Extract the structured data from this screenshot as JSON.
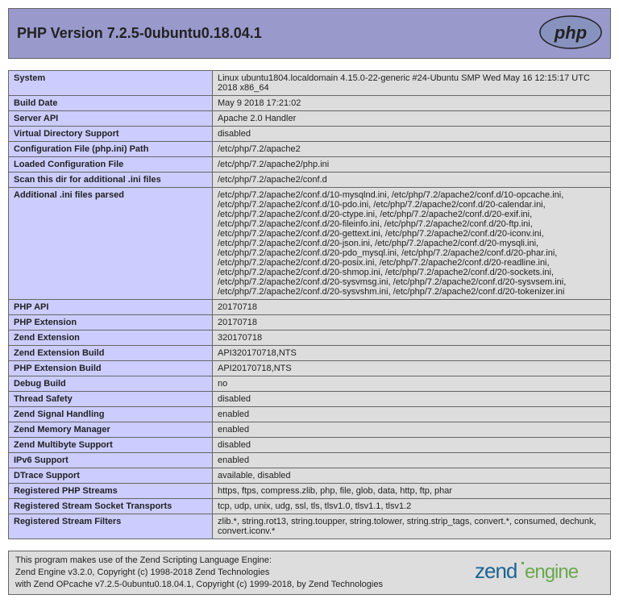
{
  "header": {
    "title": "PHP Version 7.2.5-0ubuntu0.18.04.1",
    "logo_text": "php"
  },
  "rows": [
    {
      "label": "System",
      "value": "Linux ubuntu1804.localdomain 4.15.0-22-generic #24-Ubuntu SMP Wed May 16 12:15:17 UTC 2018 x86_64"
    },
    {
      "label": "Build Date",
      "value": "May 9 2018 17:21:02"
    },
    {
      "label": "Server API",
      "value": "Apache 2.0 Handler"
    },
    {
      "label": "Virtual Directory Support",
      "value": "disabled"
    },
    {
      "label": "Configuration File (php.ini) Path",
      "value": "/etc/php/7.2/apache2"
    },
    {
      "label": "Loaded Configuration File",
      "value": "/etc/php/7.2/apache2/php.ini"
    },
    {
      "label": "Scan this dir for additional .ini files",
      "value": "/etc/php/7.2/apache2/conf.d"
    },
    {
      "label": "Additional .ini files parsed",
      "value": "/etc/php/7.2/apache2/conf.d/10-mysqlnd.ini, /etc/php/7.2/apache2/conf.d/10-opcache.ini, /etc/php/7.2/apache2/conf.d/10-pdo.ini, /etc/php/7.2/apache2/conf.d/20-calendar.ini, /etc/php/7.2/apache2/conf.d/20-ctype.ini, /etc/php/7.2/apache2/conf.d/20-exif.ini, /etc/php/7.2/apache2/conf.d/20-fileinfo.ini, /etc/php/7.2/apache2/conf.d/20-ftp.ini, /etc/php/7.2/apache2/conf.d/20-gettext.ini, /etc/php/7.2/apache2/conf.d/20-iconv.ini, /etc/php/7.2/apache2/conf.d/20-json.ini, /etc/php/7.2/apache2/conf.d/20-mysqli.ini, /etc/php/7.2/apache2/conf.d/20-pdo_mysql.ini, /etc/php/7.2/apache2/conf.d/20-phar.ini, /etc/php/7.2/apache2/conf.d/20-posix.ini, /etc/php/7.2/apache2/conf.d/20-readline.ini, /etc/php/7.2/apache2/conf.d/20-shmop.ini, /etc/php/7.2/apache2/conf.d/20-sockets.ini, /etc/php/7.2/apache2/conf.d/20-sysvmsg.ini, /etc/php/7.2/apache2/conf.d/20-sysvsem.ini, /etc/php/7.2/apache2/conf.d/20-sysvshm.ini, /etc/php/7.2/apache2/conf.d/20-tokenizer.ini"
    },
    {
      "label": "PHP API",
      "value": "20170718"
    },
    {
      "label": "PHP Extension",
      "value": "20170718"
    },
    {
      "label": "Zend Extension",
      "value": "320170718"
    },
    {
      "label": "Zend Extension Build",
      "value": "API320170718,NTS"
    },
    {
      "label": "PHP Extension Build",
      "value": "API20170718,NTS"
    },
    {
      "label": "Debug Build",
      "value": "no"
    },
    {
      "label": "Thread Safety",
      "value": "disabled"
    },
    {
      "label": "Zend Signal Handling",
      "value": "enabled"
    },
    {
      "label": "Zend Memory Manager",
      "value": "enabled"
    },
    {
      "label": "Zend Multibyte Support",
      "value": "disabled"
    },
    {
      "label": "IPv6 Support",
      "value": "enabled"
    },
    {
      "label": "DTrace Support",
      "value": "available, disabled"
    },
    {
      "label": "Registered PHP Streams",
      "value": "https, ftps, compress.zlib, php, file, glob, data, http, ftp, phar"
    },
    {
      "label": "Registered Stream Socket Transports",
      "value": "tcp, udp, unix, udg, ssl, tls, tlsv1.0, tlsv1.1, tlsv1.2"
    },
    {
      "label": "Registered Stream Filters",
      "value": "zlib.*, string.rot13, string.toupper, string.tolower, string.strip_tags, convert.*, consumed, dechunk, convert.iconv.*"
    }
  ],
  "footer": {
    "text": "This program makes use of the Zend Scripting Language Engine:\nZend Engine v3.2.0, Copyright (c) 1998-2018 Zend Technologies\n    with Zend OPcache v7.2.5-0ubuntu0.18.04.1, Copyright (c) 1999-2018, by Zend Technologies",
    "logo_primary": "zend",
    "logo_secondary": "engine"
  }
}
